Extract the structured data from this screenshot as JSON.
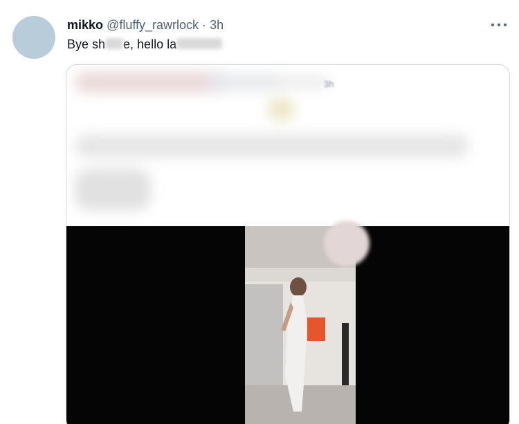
{
  "tweet": {
    "display_name": "mikko",
    "handle": "@fluffy_rawrlock",
    "separator": "·",
    "time": "3h",
    "text_parts": [
      "Bye sh",
      "e, hello la"
    ],
    "more_icon": "ellipsis-icon"
  },
  "quoted_tweet": {
    "time_fragment": "3h",
    "content": "blurred"
  },
  "colors": {
    "avatar": "#b8ccd9",
    "secondary_text": "#536471",
    "border": "#cfd9de"
  }
}
